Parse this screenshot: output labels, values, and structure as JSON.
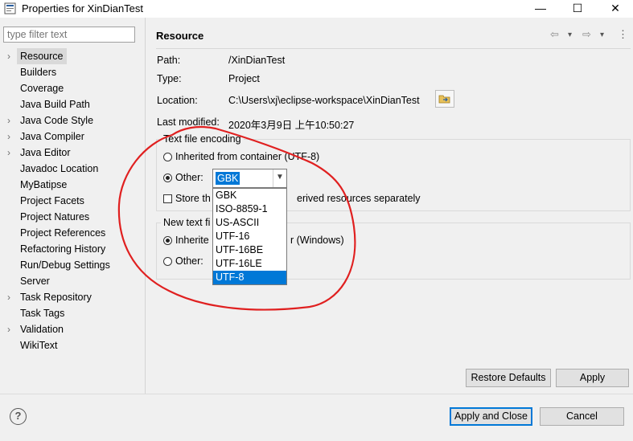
{
  "window": {
    "title": "Properties for XinDianTest",
    "minimize": "—",
    "maximize": "☐",
    "close": "✕"
  },
  "sidebar": {
    "filter_placeholder": "type filter text",
    "items": [
      {
        "label": "Resource",
        "arrow": "›",
        "selected": true
      },
      {
        "label": "Builders",
        "arrow": ""
      },
      {
        "label": "Coverage",
        "arrow": ""
      },
      {
        "label": "Java Build Path",
        "arrow": ""
      },
      {
        "label": "Java Code Style",
        "arrow": "›"
      },
      {
        "label": "Java Compiler",
        "arrow": "›"
      },
      {
        "label": "Java Editor",
        "arrow": "›"
      },
      {
        "label": "Javadoc Location",
        "arrow": ""
      },
      {
        "label": "MyBatipse",
        "arrow": ""
      },
      {
        "label": "Project Facets",
        "arrow": ""
      },
      {
        "label": "Project Natures",
        "arrow": ""
      },
      {
        "label": "Project References",
        "arrow": ""
      },
      {
        "label": "Refactoring History",
        "arrow": ""
      },
      {
        "label": "Run/Debug Settings",
        "arrow": ""
      },
      {
        "label": "Server",
        "arrow": ""
      },
      {
        "label": "Task Repository",
        "arrow": "›"
      },
      {
        "label": "Task Tags",
        "arrow": ""
      },
      {
        "label": "Validation",
        "arrow": "›"
      },
      {
        "label": "WikiText",
        "arrow": ""
      }
    ]
  },
  "page": {
    "title": "Resource",
    "nav_back": "⇦",
    "nav_back_menu": "▾",
    "nav_forward": "⇨",
    "nav_forward_menu": "▾",
    "nav_more": "⋮",
    "path_label": "Path:",
    "path_value": "/XinDianTest",
    "type_label": "Type:",
    "type_value": "Project",
    "location_label": "Location:",
    "location_value": "C:\\Users\\xj\\eclipse-workspace\\XinDianTest",
    "modified_label": "Last modified:",
    "modified_value": "2020年3月9日 上午10:50:27"
  },
  "encoding": {
    "group_title": "Text file encoding",
    "inherited_label": "Inherited from container (UTF-8)",
    "inherited_selected": false,
    "other_label": "Other:",
    "other_selected": true,
    "combo_value": "GBK",
    "store_label": "Store the encoding of derived resources separately",
    "store_prefix": "Store th",
    "store_suffix": "erived resources separately",
    "store_checked": false,
    "options": [
      "GBK",
      "ISO-8859-1",
      "US-ASCII",
      "UTF-16",
      "UTF-16BE",
      "UTF-16LE",
      "UTF-8"
    ],
    "highlighted_option": "UTF-8"
  },
  "delimiter": {
    "group_title_visible": "New text fi",
    "inherited_prefix": "Inherite",
    "inherited_suffix": "r (Windows)",
    "inherited_selected": true,
    "other_label": "Other:",
    "other_selected": false
  },
  "buttons": {
    "restore_defaults": "Restore Defaults",
    "apply": "Apply",
    "apply_and_close": "Apply and Close",
    "cancel": "Cancel",
    "help": "?"
  },
  "colors": {
    "accent": "#0078d7",
    "annotation": "#e02020"
  }
}
